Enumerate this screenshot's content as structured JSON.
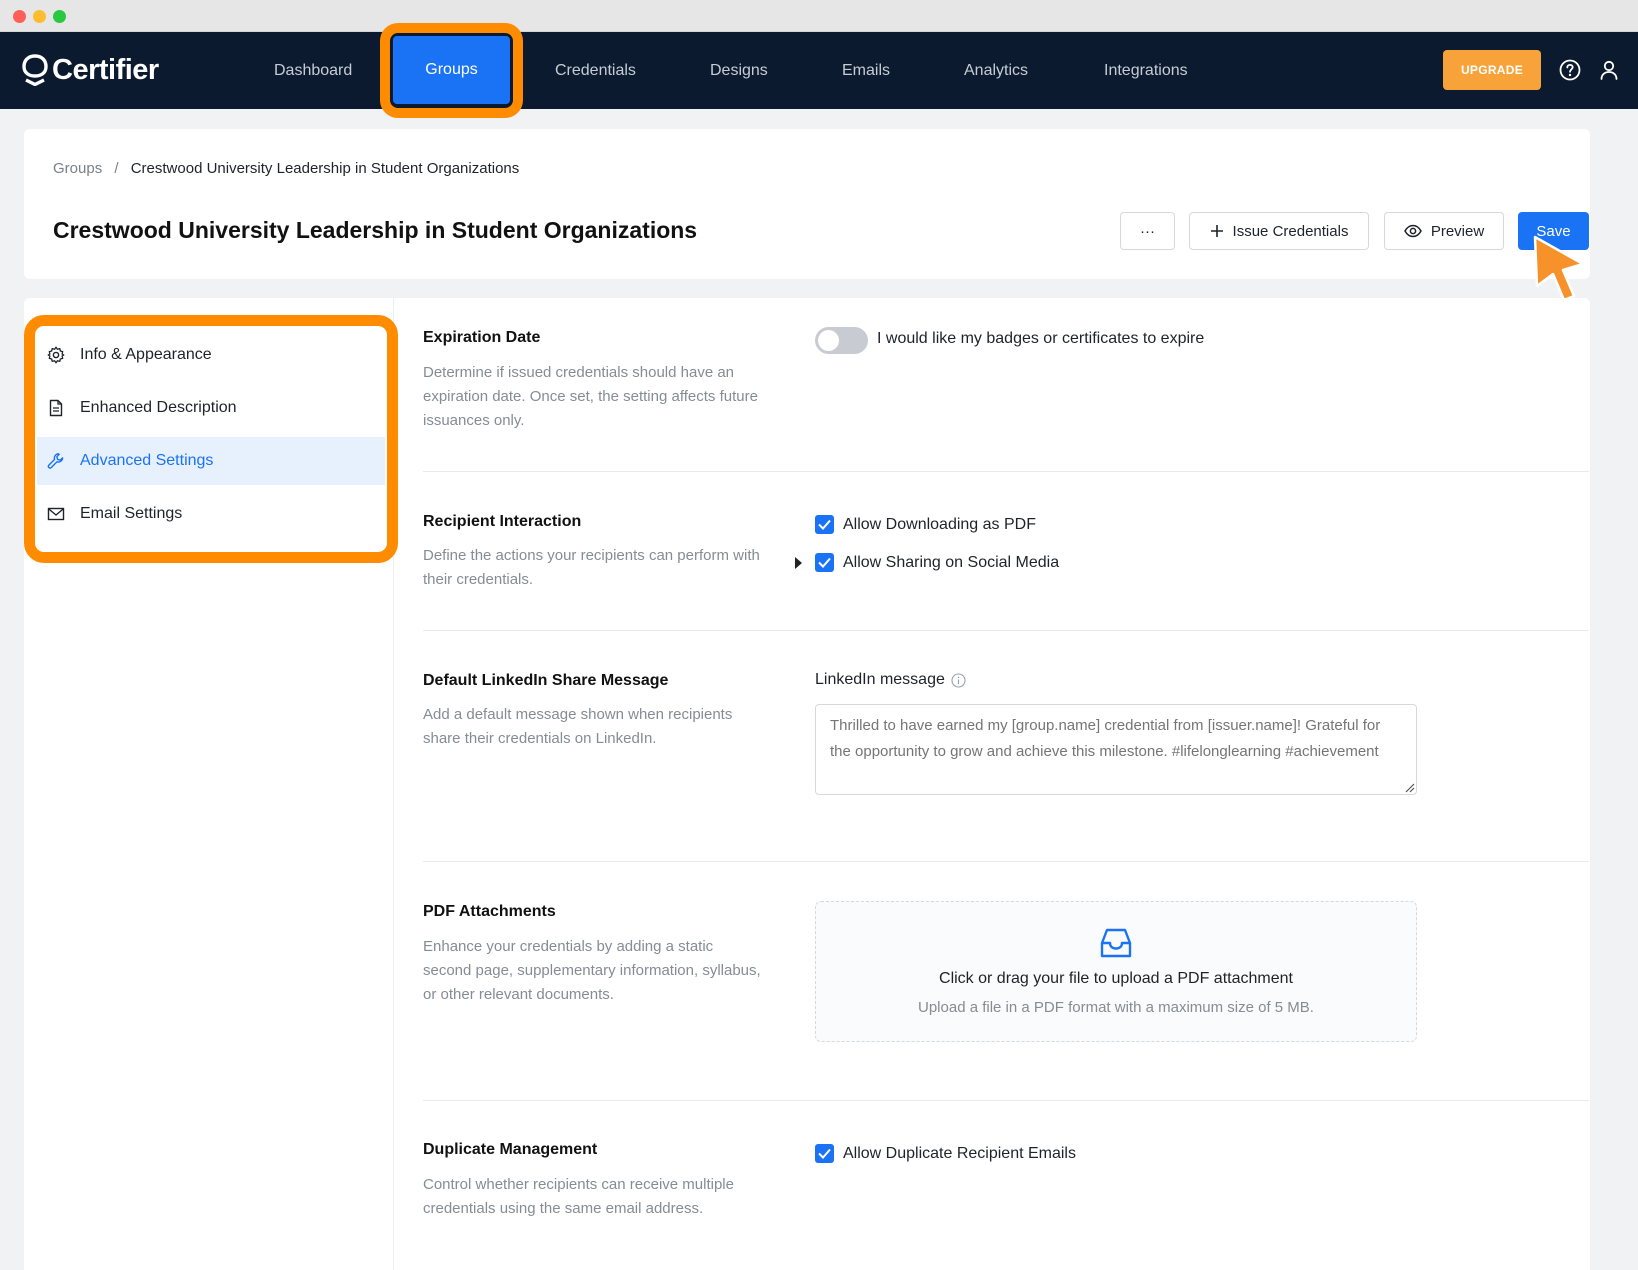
{
  "app": {
    "logo_text": "Certifier"
  },
  "nav": {
    "items": [
      "Dashboard",
      "Groups",
      "Credentials",
      "Designs",
      "Emails",
      "Analytics",
      "Integrations"
    ],
    "active": "Groups",
    "upgrade_label": "UPGRADE"
  },
  "header": {
    "breadcrumb_root": "Groups",
    "breadcrumb_sep": "/",
    "breadcrumb_current": "Crestwood University Leadership in Student Organizations",
    "title": "Crestwood University Leadership in Student Organizations",
    "more_label": "···",
    "issue_label": "Issue Credentials",
    "preview_label": "Preview",
    "save_label": "Save"
  },
  "sidebar": {
    "items": [
      {
        "label": "Info & Appearance",
        "icon": "gear-icon"
      },
      {
        "label": "Enhanced Description",
        "icon": "document-icon"
      },
      {
        "label": "Advanced Settings",
        "icon": "wrench-icon"
      },
      {
        "label": "Email Settings",
        "icon": "mail-icon"
      }
    ],
    "active": "Advanced Settings"
  },
  "sections": {
    "expiration": {
      "title": "Expiration Date",
      "description": "Determine if issued credentials should have an expiration date. Once set, the setting affects future issuances only.",
      "toggle_label": "I would like my badges or certificates to expire",
      "toggle_on": false
    },
    "interaction": {
      "title": "Recipient Interaction",
      "description": "Define the actions your recipients can perform with their credentials.",
      "option_pdf": "Allow Downloading as PDF",
      "option_social": "Allow Sharing on Social Media"
    },
    "linkedin": {
      "title": "Default LinkedIn Share Message",
      "description": "Add a default message shown when recipients share their credentials on LinkedIn.",
      "field_label": "LinkedIn message",
      "placeholder": "Thrilled to have earned my [group.name] credential from [issuer.name]! Grateful for the opportunity to grow and achieve this milestone. #lifelonglearning #achievement"
    },
    "pdf": {
      "title": "PDF Attachments",
      "description": "Enhance your credentials by adding a static second page, supplementary information, syllabus, or other relevant documents.",
      "upload_main": "Click or drag your file to upload a PDF attachment",
      "upload_sub": "Upload a file in a PDF format with a maximum size of 5 MB."
    },
    "duplicate": {
      "title": "Duplicate Management",
      "description": "Control whether recipients can receive multiple credentials using the same email address.",
      "option": "Allow Duplicate Recipient Emails"
    }
  },
  "colors": {
    "nav_bg": "#0b1a2e",
    "primary": "#1a73f5",
    "highlight": "#ff8c00",
    "upgrade": "#f8a33a"
  }
}
